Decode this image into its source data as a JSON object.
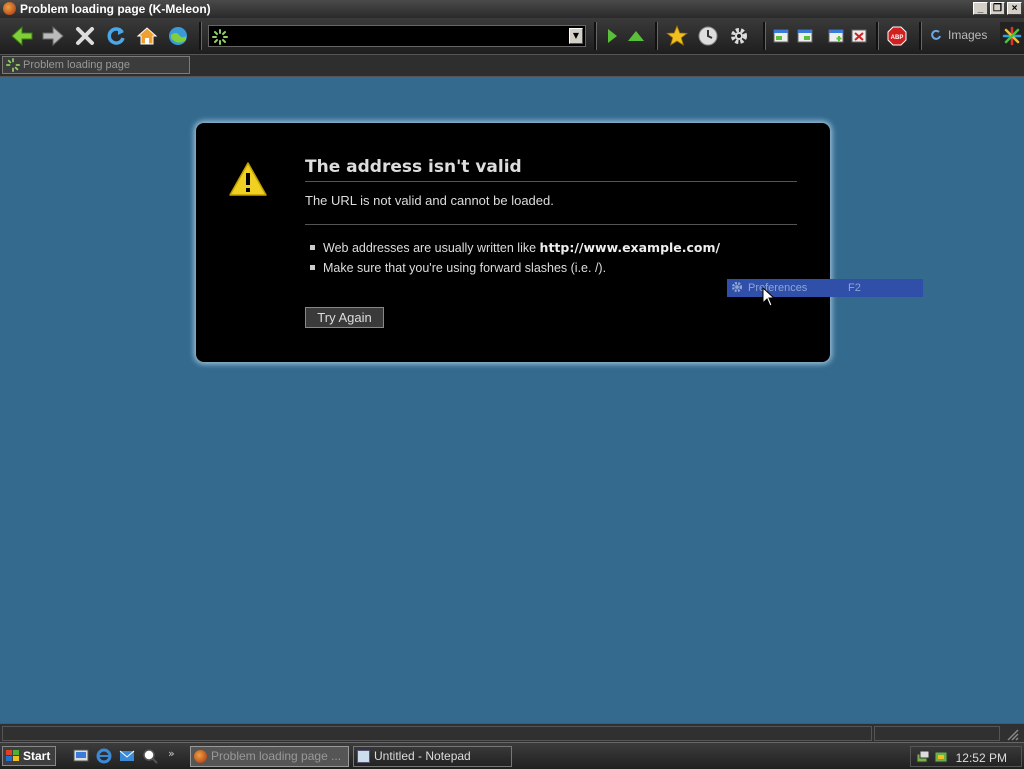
{
  "window": {
    "title": "Problem loading page (K-Meleon)"
  },
  "toolbar": {
    "buttons": [
      "back-icon",
      "forward-icon",
      "stop-icon",
      "reload-icon",
      "home-icon",
      "search-icon"
    ],
    "images_label": "Images"
  },
  "tab": {
    "label": "Problem loading page"
  },
  "error": {
    "title": "The address isn't valid",
    "description": "The URL is not valid and cannot be loaded.",
    "bullet1_prefix": "Web addresses are usually written like ",
    "bullet1_example": "http://www.example.com/",
    "bullet2": "Make sure that you're using forward slashes (i.e. /).",
    "try_again": "Try Again"
  },
  "menu_item": {
    "label": "Preferences",
    "shortcut": "F2"
  },
  "taskbar": {
    "start_label": "Start",
    "tasks": [
      {
        "label": "Problem loading page ...",
        "active": true
      },
      {
        "label": "Untitled - Notepad",
        "active": false
      }
    ],
    "clock": "12:52 PM"
  },
  "colors": {
    "page_bg": "#336a8e",
    "error_bg": "#000000",
    "highlight": "#2f4fa8"
  }
}
